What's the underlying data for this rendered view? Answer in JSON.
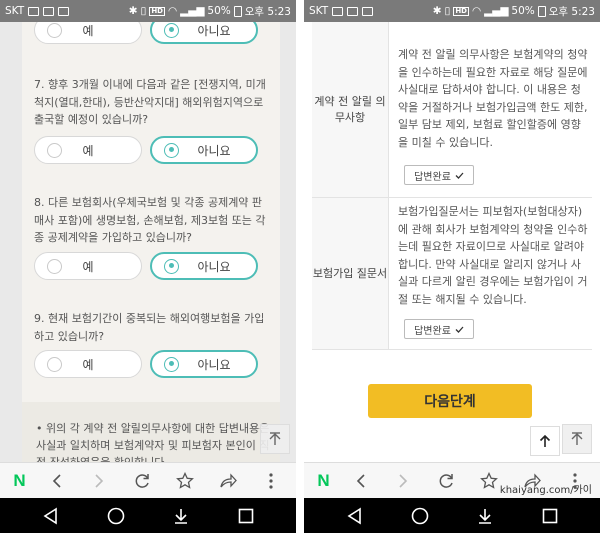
{
  "status": {
    "carrier": "SKT",
    "hd": "HD",
    "voice": "Voice",
    "battery": "50%",
    "time": "오후 5:23"
  },
  "left": {
    "q6_options": {
      "yes": "예",
      "no": "아니요"
    },
    "q7": {
      "text": "7. 향후 3개월 이내에 다음과 같은 [전쟁지역, 미개척지(열대,한대), 등반산악지대] 해외위험지역으로 출국할 예정이 있습니까?",
      "yes": "예",
      "no": "아니요"
    },
    "q8": {
      "text": "8. 다른 보험회사(우체국보험 및 각종 공제계약 판매사 포함)에 생명보험, 손해보험, 제3보험 또는 각종 공제계약을 가입하고 있습니까?",
      "yes": "예",
      "no": "아니요"
    },
    "q9": {
      "text": "9. 현재 보험기간이 중복되는 해외여행보험을 가입하고 있습니까?",
      "yes": "예",
      "no": "아니요"
    },
    "notice": "• 위의 각 계약 전 알릴의무사항에 대한 답변내용은 사실과 일치하며 보험계약자 및 피보험자 본인이 직접 작성하였음을 확인합니다."
  },
  "right": {
    "row1": {
      "head": "계약 전 알릴 의무사항",
      "body": "계약 전 알릴 의무사항은 보험계약의 청약을 인수하는데 필요한 자료로 해당 질문에 사실대로 답하셔야 합니다. 이 내용은 청약을 거절하거나 보험가입금액 한도 제한, 일부 담보 제외, 보험료 할인할증에 영향을 미칠 수 있습니다.",
      "button": "답변완료"
    },
    "row2": {
      "head": "보험가입 질문서",
      "body": "보험가입질문서는 피보험자(보험대상자)에 관해 회사가 보험계약의 청약을 인수하는데 필요한 자료이므로 사실대로 알려야 합니다. 만약 사실대로 알리지 않거나 사실과 다르게 알린 경우에는 보험가입이 거절 또는 해지될 수 있습니다.",
      "button": "답변완료"
    },
    "next_button": "다음단계"
  },
  "toolbar": {
    "naver": "N"
  },
  "watermark": "khaiyang.com/카이"
}
